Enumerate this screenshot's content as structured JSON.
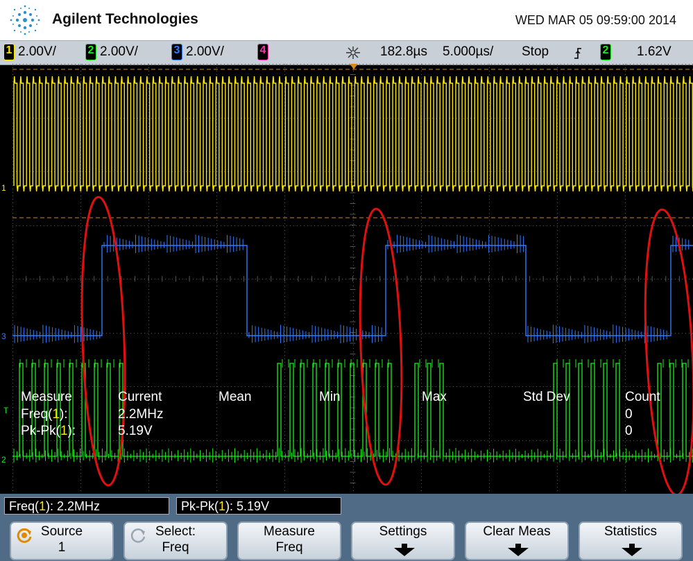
{
  "header": {
    "brand": "Agilent Technologies",
    "datetime": "WED MAR 05 09:59:00 2014"
  },
  "status": {
    "ch1_num": "1",
    "ch1_scale": "2.00V/",
    "ch2_num": "2",
    "ch2_scale": "2.00V/",
    "ch3_num": "3",
    "ch3_scale": "2.00V/",
    "ch4_num": "4",
    "delay": "182.8µs",
    "timebase": "5.000µs/",
    "run_state": "Stop",
    "trigger_source": "2",
    "trigger_level": "1.62V"
  },
  "channel_markers": {
    "ch1": "1",
    "ch2": "2",
    "ch3": "3",
    "trigger": "T"
  },
  "measurements": {
    "headers": [
      "Measure",
      "Current",
      "Mean",
      "Min",
      "Max",
      "Std Dev",
      "Count"
    ],
    "rows": [
      {
        "name_prefix": "Freq(",
        "ch": "1",
        "name_suffix": "):",
        "current": "2.2MHz",
        "count": "0"
      },
      {
        "name_prefix": "Pk-Pk(",
        "ch": "1",
        "name_suffix": "):",
        "current": "5.19V",
        "count": "0"
      }
    ]
  },
  "readouts": [
    {
      "prefix": "Freq(",
      "ch": "1",
      "suffix": "): 2.2MHz"
    },
    {
      "prefix": "Pk-Pk(",
      "ch": "1",
      "suffix": "): 5.19V"
    }
  ],
  "softkeys": [
    {
      "l1": "Source",
      "l2": "1",
      "icon": "rotary-knob-icon"
    },
    {
      "l1": "Select:",
      "l2": "Freq",
      "icon": "rotary-knob-icon"
    },
    {
      "l1": "Measure",
      "l2": "Freq"
    },
    {
      "l1": "Settings",
      "l2": "",
      "icon": "down-arrow-icon"
    },
    {
      "l1": "Clear Meas",
      "l2": "",
      "icon": "down-arrow-icon"
    },
    {
      "l1": "Statistics",
      "l2": "",
      "icon": "down-arrow-icon"
    }
  ],
  "colors": {
    "ch1": "#ffe800",
    "ch2": "#18f018",
    "ch3": "#2f7bff",
    "ch4": "#ff2fb0",
    "annotation": "#e01010",
    "footer": "#506b85"
  }
}
